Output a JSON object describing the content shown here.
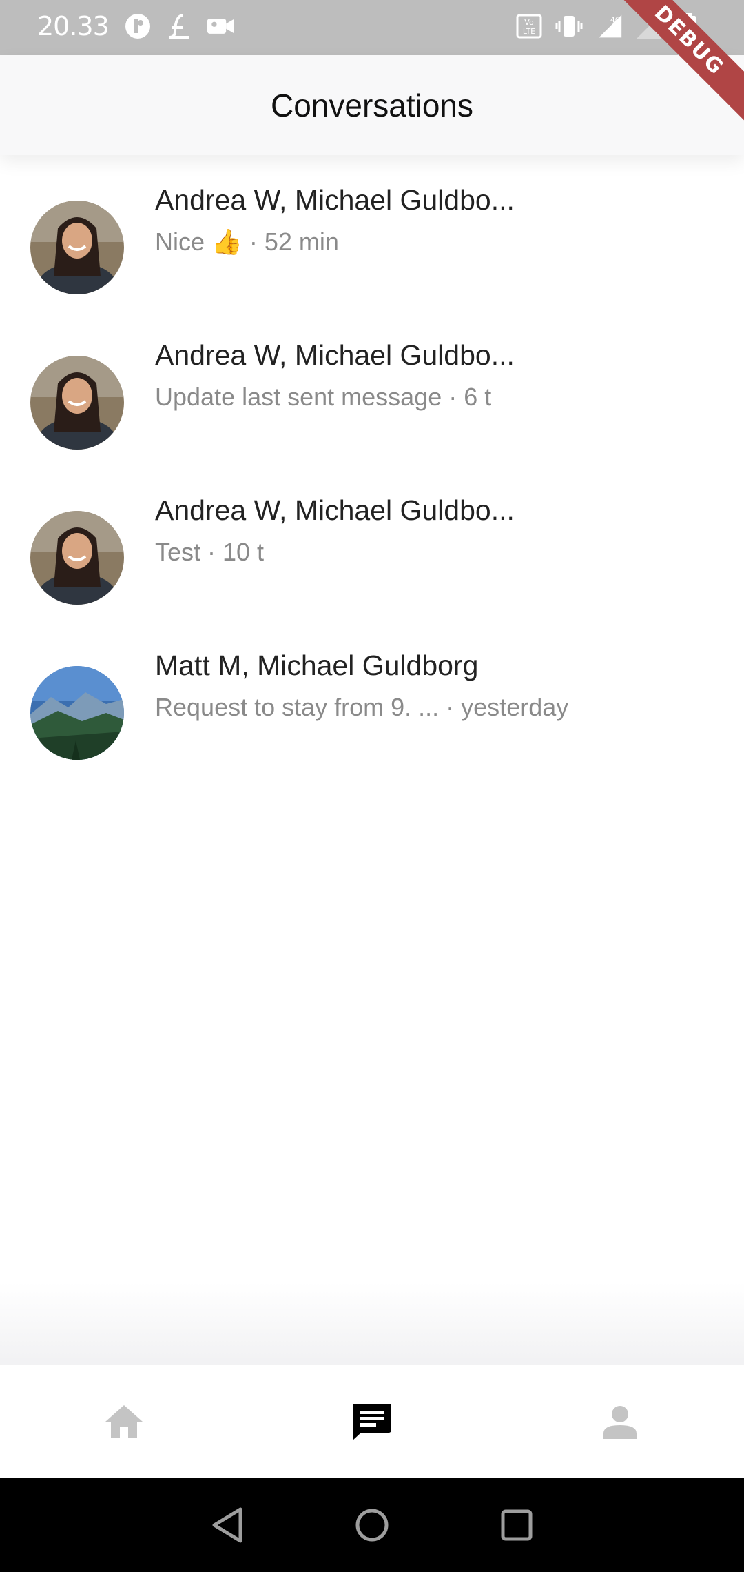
{
  "status_bar": {
    "time": "20.33",
    "debug_label": "DEBUG",
    "network_label": "4G"
  },
  "app_bar": {
    "title": "Conversations"
  },
  "conversations": [
    {
      "name": "Andrea W, Michael Guldbo...",
      "subtitle": "Nice 👍 · 52 min",
      "avatar": "person-avatar"
    },
    {
      "name": "Andrea W, Michael Guldbo...",
      "subtitle": "Update last sent message · 6 t",
      "avatar": "person-avatar"
    },
    {
      "name": "Andrea W, Michael Guldbo...",
      "subtitle": "Test · 10 t",
      "avatar": "person-avatar"
    },
    {
      "name": "Matt M, Michael Guldborg",
      "subtitle": "Request to stay from 9. ... · yesterday",
      "avatar": "mountain-avatar"
    }
  ],
  "bottom_nav": {
    "items": [
      {
        "icon": "home-icon",
        "active": false
      },
      {
        "icon": "chat-icon",
        "active": true
      },
      {
        "icon": "person-icon",
        "active": false
      }
    ],
    "colors": {
      "active": "#000000",
      "inactive": "#c4c4c4"
    }
  },
  "system_nav": {
    "buttons": [
      "back-icon",
      "home-circle-icon",
      "recents-icon"
    ]
  }
}
